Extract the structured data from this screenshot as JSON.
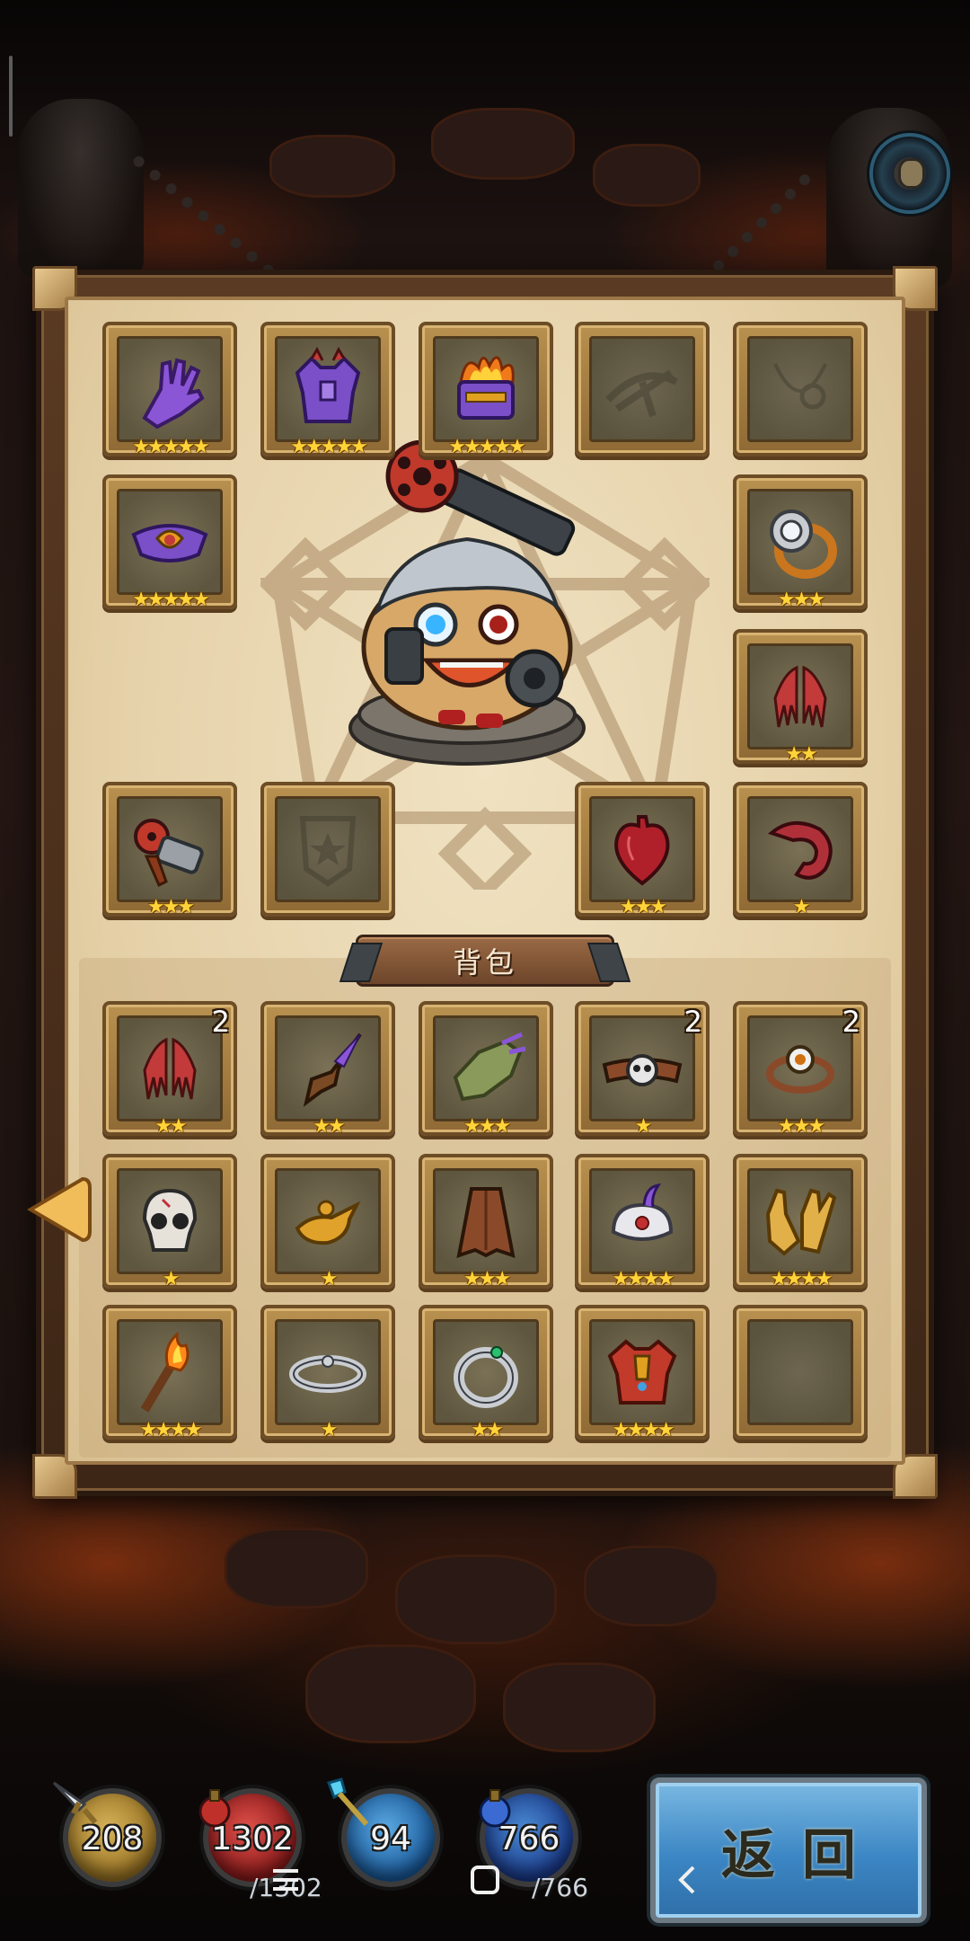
{
  "colors": {
    "parchment": "#e6d2aa",
    "slot_frame": "#b8904f",
    "star": "#ffd43a",
    "back_button": "#3b86c4"
  },
  "equipment": {
    "slots": [
      {
        "name": "glove-slot",
        "icon": "purple-gauntlet-icon",
        "stars": "★★★★★"
      },
      {
        "name": "armor-slot",
        "icon": "purple-chest-armor-icon",
        "stars": "★★★★★"
      },
      {
        "name": "helmet-slot",
        "icon": "flaming-purple-helm-icon",
        "stars": "★★★★★"
      },
      {
        "name": "weapon-slot-empty",
        "icon": "crossbow-silhouette-icon",
        "stars": ""
      },
      {
        "name": "necklace-slot-empty",
        "icon": "amulet-silhouette-icon",
        "stars": ""
      },
      {
        "name": "belt-slot",
        "icon": "purple-belt-icon",
        "stars": "★★★★★"
      },
      {
        "name": "ring-slot",
        "icon": "silver-ring-icon",
        "stars": "★★★"
      },
      {
        "name": "cape-slot",
        "icon": "red-claws-icon",
        "stars": "★★"
      },
      {
        "name": "gatling-slot",
        "icon": "gatling-gun-icon",
        "stars": "★★★"
      },
      {
        "name": "badge-slot-empty",
        "icon": "badge-silhouette-icon",
        "stars": ""
      },
      {
        "name": "heart-slot",
        "icon": "heart-icon",
        "stars": "★★★"
      },
      {
        "name": "horn-slot",
        "icon": "red-horn-icon",
        "stars": "★"
      }
    ]
  },
  "backpack": {
    "title": "背包",
    "items": [
      {
        "icon": "red-claws-icon",
        "stars": "★★",
        "count": "2"
      },
      {
        "icon": "horn-dagger-icon",
        "stars": "★★",
        "count": ""
      },
      {
        "icon": "rotten-glove-icon",
        "stars": "★★★",
        "count": ""
      },
      {
        "icon": "skull-belt-icon",
        "stars": "★",
        "count": "2"
      },
      {
        "icon": "eye-bracelet-icon",
        "stars": "★★★",
        "count": "2"
      },
      {
        "icon": "skull-icon",
        "stars": "★",
        "count": ""
      },
      {
        "icon": "magic-lamp-icon",
        "stars": "★",
        "count": ""
      },
      {
        "icon": "leather-cloak-icon",
        "stars": "★★★",
        "count": ""
      },
      {
        "icon": "turban-icon",
        "stars": "★★★★",
        "count": ""
      },
      {
        "icon": "leather-gloves-icon",
        "stars": "★★★★",
        "count": ""
      },
      {
        "icon": "torch-icon",
        "stars": "★★★★",
        "count": ""
      },
      {
        "icon": "silver-band-icon",
        "stars": "★",
        "count": ""
      },
      {
        "icon": "emerald-ring-icon",
        "stars": "★★",
        "count": ""
      },
      {
        "icon": "crimson-armor-icon",
        "stars": "★★★★",
        "count": ""
      },
      {
        "icon": "",
        "stars": "",
        "count": ""
      }
    ]
  },
  "resources": {
    "attack": {
      "value": "208",
      "icon": "sword-icon"
    },
    "health": {
      "value": "1302",
      "sub": "/1302",
      "icon": "red-potion-icon"
    },
    "magic": {
      "value": "94",
      "icon": "magic-staff-icon"
    },
    "mana": {
      "value": "766",
      "sub": "/766",
      "icon": "blue-potion-icon"
    }
  },
  "back_button": {
    "label": "返回"
  },
  "system_nav": {
    "menu": "menu-icon",
    "home": "home-icon",
    "back": "back-chevron-icon"
  }
}
